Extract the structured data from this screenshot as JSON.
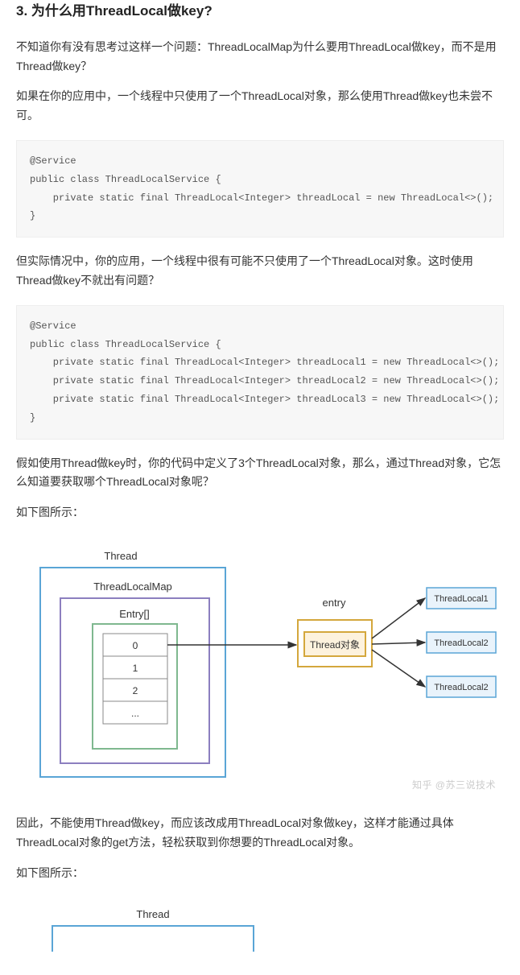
{
  "heading": "3. 为什么用ThreadLocal做key?",
  "p1": "不知道你有没有思考过这样一个问题：ThreadLocalMap为什么要用ThreadLocal做key，而不是用Thread做key？",
  "p2": "如果在你的应用中，一个线程中只使用了一个ThreadLocal对象，那么使用Thread做key也未尝不可。",
  "code1": "@Service\npublic class ThreadLocalService {\n    private static final ThreadLocal<Integer> threadLocal = new ThreadLocal<>();\n}",
  "p3": "但实际情况中，你的应用，一个线程中很有可能不只使用了一个ThreadLocal对象。这时使用Thread做key不就出有问题？",
  "code2": "@Service\npublic class ThreadLocalService {\n    private static final ThreadLocal<Integer> threadLocal1 = new ThreadLocal<>();\n    private static final ThreadLocal<Integer> threadLocal2 = new ThreadLocal<>();\n    private static final ThreadLocal<Integer> threadLocal3 = new ThreadLocal<>();\n}",
  "p4": "假如使用Thread做key时，你的代码中定义了3个ThreadLocal对象，那么，通过Thread对象，它怎么知道要获取哪个ThreadLocal对象呢？",
  "p5": "如下图所示：",
  "diagram1": {
    "thread_label": "Thread",
    "map_label": "ThreadLocalMap",
    "entry_arr_label": "Entry[]",
    "cells": [
      "0",
      "1",
      "2",
      "..."
    ],
    "entry_label": "entry",
    "thread_obj_label": "Thread对象",
    "targets": [
      "ThreadLocal1",
      "ThreadLocal2",
      "ThreadLocal2"
    ]
  },
  "watermark": "知乎 @苏三说技术",
  "p6": "因此，不能使用Thread做key，而应该改成用ThreadLocal对象做key，这样才能通过具体ThreadLocal对象的get方法，轻松获取到你想要的ThreadLocal对象。",
  "p7": "如下图所示：",
  "diagram2": {
    "thread_label": "Thread"
  }
}
